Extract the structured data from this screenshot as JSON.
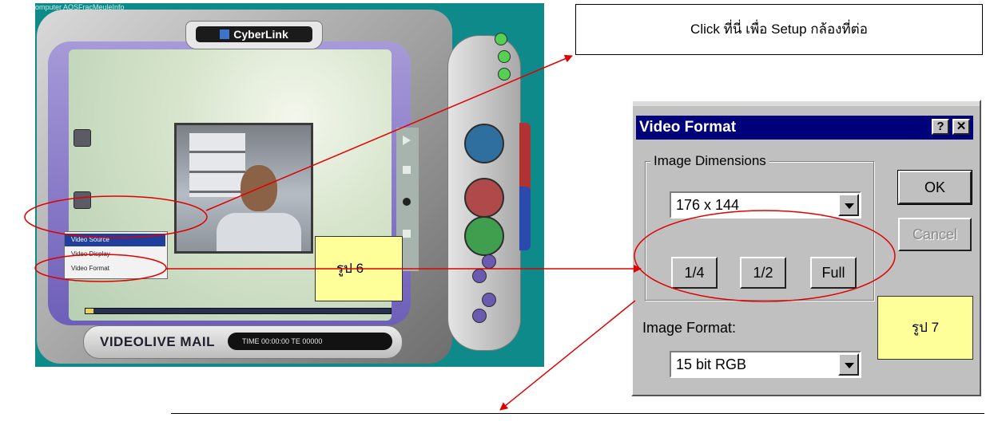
{
  "screenshot_left": {
    "desktop_text": "omputer   AOSFracMeuleInfo",
    "brand_logo": "CyberLink",
    "video_menu": {
      "items": [
        "Video Source",
        "Video Display",
        "Video Format"
      ],
      "highlighted": "Video Source"
    },
    "brand_text": "VIDEOLIVE MAIL",
    "timer": "TIME 00:00:00 TE 00000",
    "colors": {
      "desktop": "#0f8a8a",
      "panel": "#8b7fce",
      "menu_highlight": "#1e3f9c"
    }
  },
  "dialog": {
    "title": "Video Format",
    "help_button": "?",
    "close_button": "✕",
    "image_dimensions_label": "Image Dimensions",
    "dimension_value": "176 x 144",
    "size_buttons": [
      "1/4",
      "1/2",
      "Full"
    ],
    "ok_label": "OK",
    "cancel_label": "Cancel",
    "image_format_label": "Image Format:",
    "image_format_value": "15 bit RGB"
  },
  "callouts": {
    "setup_text": "Click ที่นี่ เพื่อ Setup กล้องที่ต่อ",
    "figure6": "รูป 6",
    "figure7": "รูป 7"
  },
  "annotation_colors": {
    "arrow": "#e10000",
    "ellipse": "#e10000"
  }
}
